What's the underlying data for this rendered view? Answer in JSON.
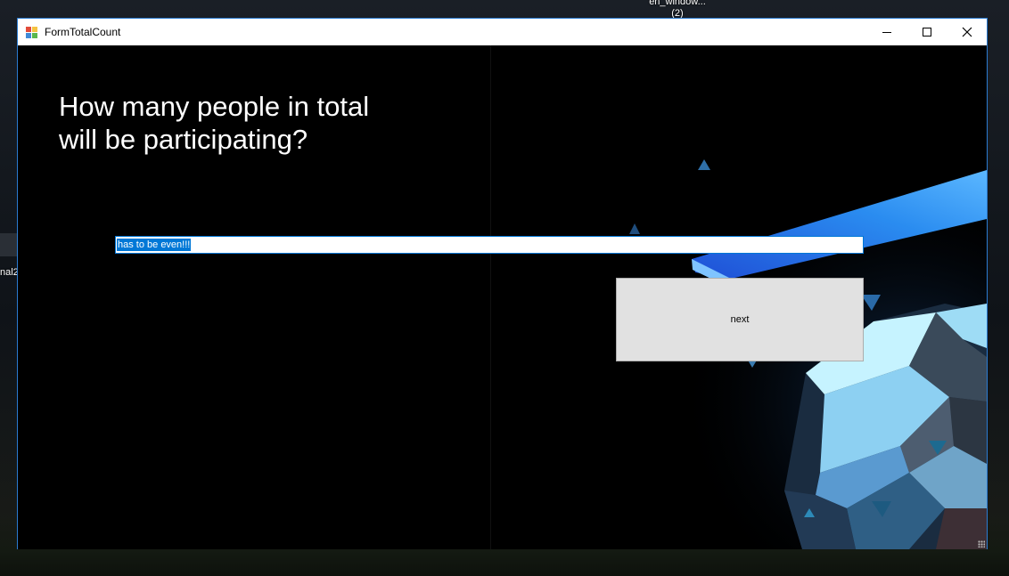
{
  "desktop": {
    "icon_label_line1": "en_window...",
    "icon_label_line2": "(2)",
    "left_label": "nal2"
  },
  "window": {
    "title": "FormTotalCount",
    "controls": {
      "minimize": "minimize-icon",
      "maximize": "maximize-icon",
      "close": "close-icon"
    }
  },
  "form": {
    "question_line1": "How many people in total",
    "question_line2": "will be participating?",
    "count_input_value": "has to be even!!!",
    "next_label": "next"
  },
  "colors": {
    "accent": "#0078d7",
    "window_border": "#2b7bd1",
    "button_face": "#e1e1e1"
  }
}
